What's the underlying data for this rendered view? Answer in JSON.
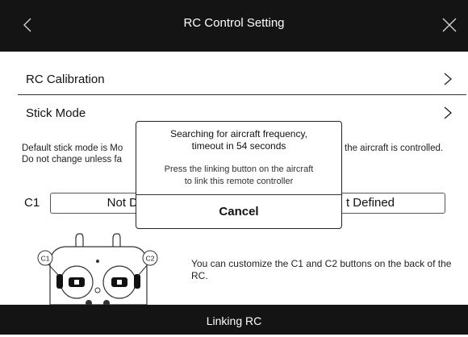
{
  "header": {
    "title": "RC Control Setting",
    "back_icon": "chevron-left-icon",
    "close_icon": "close-icon"
  },
  "rows": [
    {
      "label": "RC Calibration",
      "icon": "chevron-right-icon"
    },
    {
      "label": "Stick Mode",
      "icon": "chevron-right-icon"
    }
  ],
  "stick_mode_desc_line1_left": "Default stick mode is Mo",
  "stick_mode_desc_line1_right": "the aircraft is controlled.",
  "stick_mode_desc_line2": "Do not change unless fa",
  "buttons": {
    "c1_label": "C1",
    "c1_value": "Not De",
    "c2_value": "t Defined"
  },
  "customize_desc": "You can customize the C1 and C2 buttons on the back of the RC.",
  "illustration": {
    "c1_marker": "C1",
    "c2_marker": "C2"
  },
  "bottom_bar": {
    "label": "Linking RC"
  },
  "modal": {
    "title_line1": "Searching for aircraft frequency,",
    "title_line2": "timeout in 54 seconds",
    "sub_line1": "Press the linking button on the aircraft",
    "sub_line2": "to link this remote controller",
    "cancel_label": "Cancel"
  },
  "colors": {
    "bar_bg": "#141414",
    "bar_text": "#ffffff",
    "text": "#111111"
  }
}
